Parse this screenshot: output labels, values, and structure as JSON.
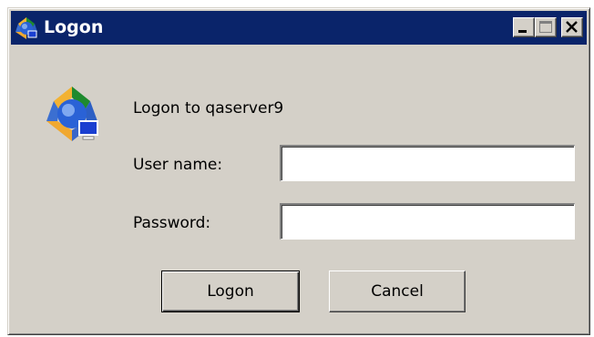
{
  "window": {
    "title": "Logon",
    "icon": "server-app-icon",
    "controls": {
      "minimize": "minimize-icon",
      "maximize": "maximize-icon",
      "close": "close-icon"
    }
  },
  "dialog": {
    "heading": "Logon to qaserver9",
    "icon": "server-app-icon",
    "username": {
      "label": "User name:",
      "value": ""
    },
    "password": {
      "label": "Password:",
      "value": ""
    },
    "buttons": {
      "logon": "Logon",
      "cancel": "Cancel"
    }
  },
  "colors": {
    "titlebar": "#0a246a",
    "face": "#d4d0c8",
    "title_text": "#ffffff"
  }
}
